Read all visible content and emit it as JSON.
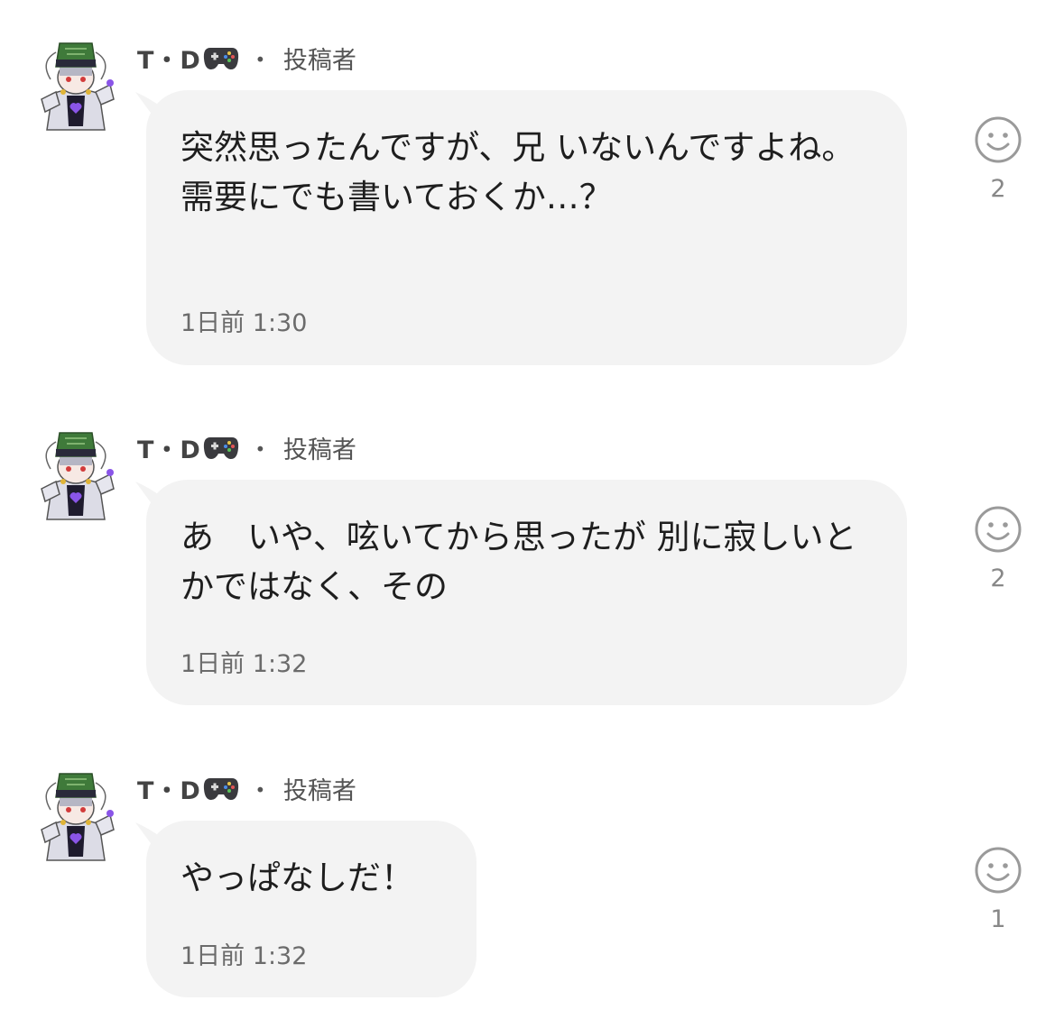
{
  "messages": [
    {
      "sender": "T・D",
      "sender_emoji": "gamepad-icon",
      "separator": "・",
      "role": "投稿者",
      "text": "突然思ったんですが、兄 いないんですよね。\n需要にでも書いておくか…？",
      "time": "1日前 1:30",
      "reaction_icon": "smiley-icon",
      "reaction_count": "2"
    },
    {
      "sender": "T・D",
      "sender_emoji": "gamepad-icon",
      "separator": "・",
      "role": "投稿者",
      "text": "あ　いや、呟いてから思ったが 別に寂しいとかではなく、その",
      "time": "1日前 1:32",
      "reaction_icon": "smiley-icon",
      "reaction_count": "2"
    },
    {
      "sender": "T・D",
      "sender_emoji": "gamepad-icon",
      "separator": "・",
      "role": "投稿者",
      "text": "やっぱなしだ！",
      "time": "1日前 1:32",
      "reaction_icon": "smiley-icon",
      "reaction_count": "1"
    }
  ],
  "colors": {
    "bubble": "#f3f3f3",
    "text": "#1e1e1e",
    "meta": "#6b6b6b",
    "hat": "#3f7a3a",
    "avatar_accent": "#6a3fd0"
  }
}
